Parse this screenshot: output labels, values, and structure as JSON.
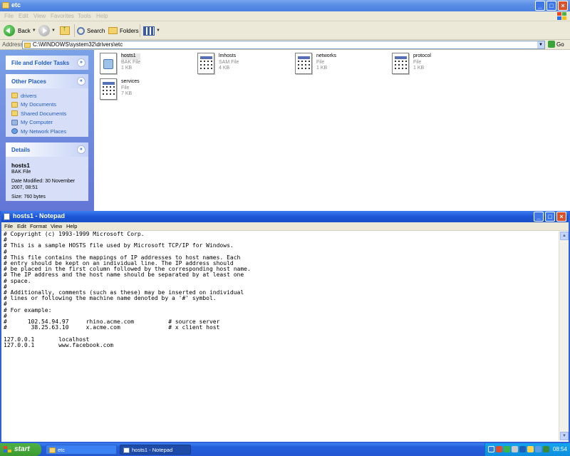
{
  "explorer": {
    "title": "etc",
    "menu": [
      "File",
      "Edit",
      "View",
      "Favorites",
      "Tools",
      "Help"
    ],
    "toolbar": {
      "back": "Back",
      "search": "Search",
      "folders": "Folders"
    },
    "address": {
      "label": "Address",
      "value": "C:\\WINDOWS\\system32\\drivers\\etc",
      "go": "Go"
    },
    "tasks_header": "File and Folder Tasks",
    "other_places": {
      "header": "Other Places",
      "items": [
        "drivers",
        "My Documents",
        "Shared Documents",
        "My Computer",
        "My Network Places"
      ]
    },
    "details": {
      "header": "Details",
      "name": "hosts1",
      "type": "BAK File",
      "modified": "Date Modified: 30 November 2007, 08:51",
      "size": "Size: 760 bytes"
    },
    "files": [
      {
        "name": "hosts1",
        "type": "BAK File",
        "size": "1 KB"
      },
      {
        "name": "lmhosts",
        "type": "SAM File",
        "size": "4 KB"
      },
      {
        "name": "networks",
        "type": "File",
        "size": "1 KB"
      },
      {
        "name": "protocol",
        "type": "File",
        "size": "1 KB"
      },
      {
        "name": "services",
        "type": "File",
        "size": "7 KB"
      }
    ]
  },
  "notepad": {
    "title": "hosts1 - Notepad",
    "menu": [
      "File",
      "Edit",
      "Format",
      "View",
      "Help"
    ],
    "content": "# Copyright (c) 1993-1999 Microsoft Corp.\n#\n# This is a sample HOSTS file used by Microsoft TCP/IP for Windows.\n#\n# This file contains the mappings of IP addresses to host names. Each\n# entry should be kept on an individual line. The IP address should\n# be placed in the first column followed by the corresponding host name.\n# The IP address and the host name should be separated by at least one\n# space.\n#\n# Additionally, comments (such as these) may be inserted on individual\n# lines or following the machine name denoted by a '#' symbol.\n#\n# For example:\n#\n#      102.54.94.97     rhino.acme.com          # source server\n#       38.25.63.10     x.acme.com              # x client host\n\n127.0.0.1       localhost\n127.0.0.1       www.facebook.com"
  },
  "taskbar": {
    "start": "start",
    "tasks": [
      "etc",
      "hosts1 - Notepad"
    ],
    "clock": "08:54"
  }
}
